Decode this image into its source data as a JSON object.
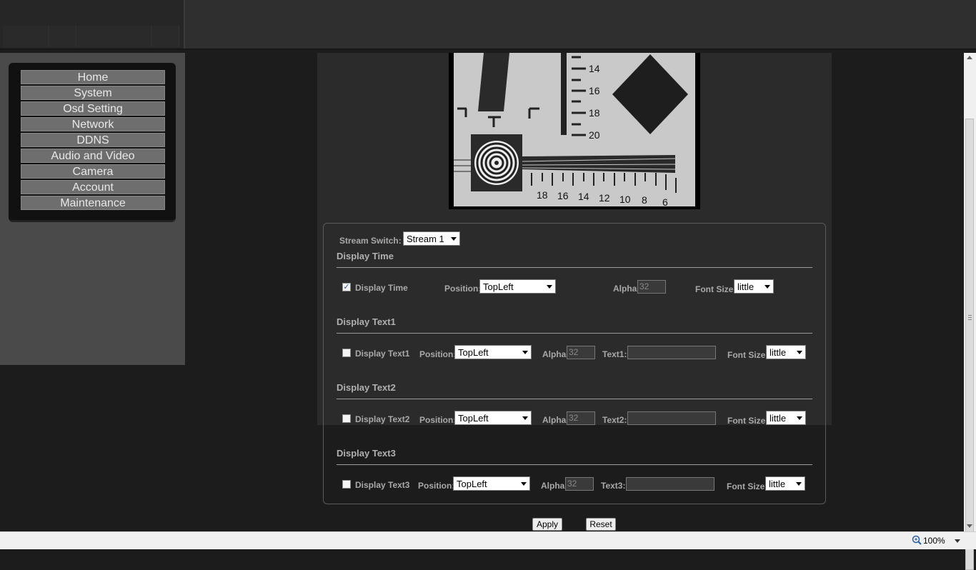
{
  "menu": {
    "items": [
      {
        "label": "Home"
      },
      {
        "label": "System"
      },
      {
        "label": "Osd Setting"
      },
      {
        "label": "Network"
      },
      {
        "label": "DDNS"
      },
      {
        "label": "Audio and Video"
      },
      {
        "label": "Camera"
      },
      {
        "label": "Account"
      },
      {
        "label": "Maintenance"
      }
    ]
  },
  "preview": {
    "ruler_numbers": [
      "14",
      "16",
      "18",
      "20"
    ],
    "bottom_numbers": [
      "18",
      "16",
      "14",
      "12",
      "10",
      "8",
      "6"
    ]
  },
  "osd": {
    "stream_switch_label": "Stream Switch:",
    "stream_value": "Stream 1",
    "time": {
      "section_title": "Display Time",
      "checkbox_label": "Display Time",
      "checked": true,
      "position_label": "Position:",
      "position_value": "TopLeft",
      "alpha_label": "Alpha:",
      "alpha_value": "32",
      "font_size_label": "Font Size:",
      "font_size_value": "little"
    },
    "text1": {
      "section_title": "Display Text1",
      "checkbox_label": "Display Text1",
      "checked": false,
      "position_label": "Position:",
      "position_value": "TopLeft",
      "alpha_label": "Alpha:",
      "alpha_value": "32",
      "text_label": "Text1:",
      "text_value": "",
      "font_size_label": "Font Size:",
      "font_size_value": "little"
    },
    "text2": {
      "section_title": "Display Text2",
      "checkbox_label": "Display Text2",
      "checked": false,
      "position_label": "Position:",
      "position_value": "TopLeft",
      "alpha_label": "Alpha:",
      "alpha_value": "32",
      "text_label": "Text2:",
      "text_value": "",
      "font_size_label": "Font Size:",
      "font_size_value": "little"
    },
    "text3": {
      "section_title": "Display Text3",
      "checkbox_label": "Display Text3",
      "checked": false,
      "position_label": "Position:",
      "position_value": "TopLeft",
      "alpha_label": "Alpha:",
      "alpha_value": "32",
      "text_label": "Text3:",
      "text_value": "",
      "font_size_label": "Font Size:",
      "font_size_value": "little"
    }
  },
  "buttons": {
    "apply": "Apply",
    "reset": "Reset"
  },
  "statusbar": {
    "zoom": "100%",
    "zoom_icon": "magnifier-icon"
  }
}
